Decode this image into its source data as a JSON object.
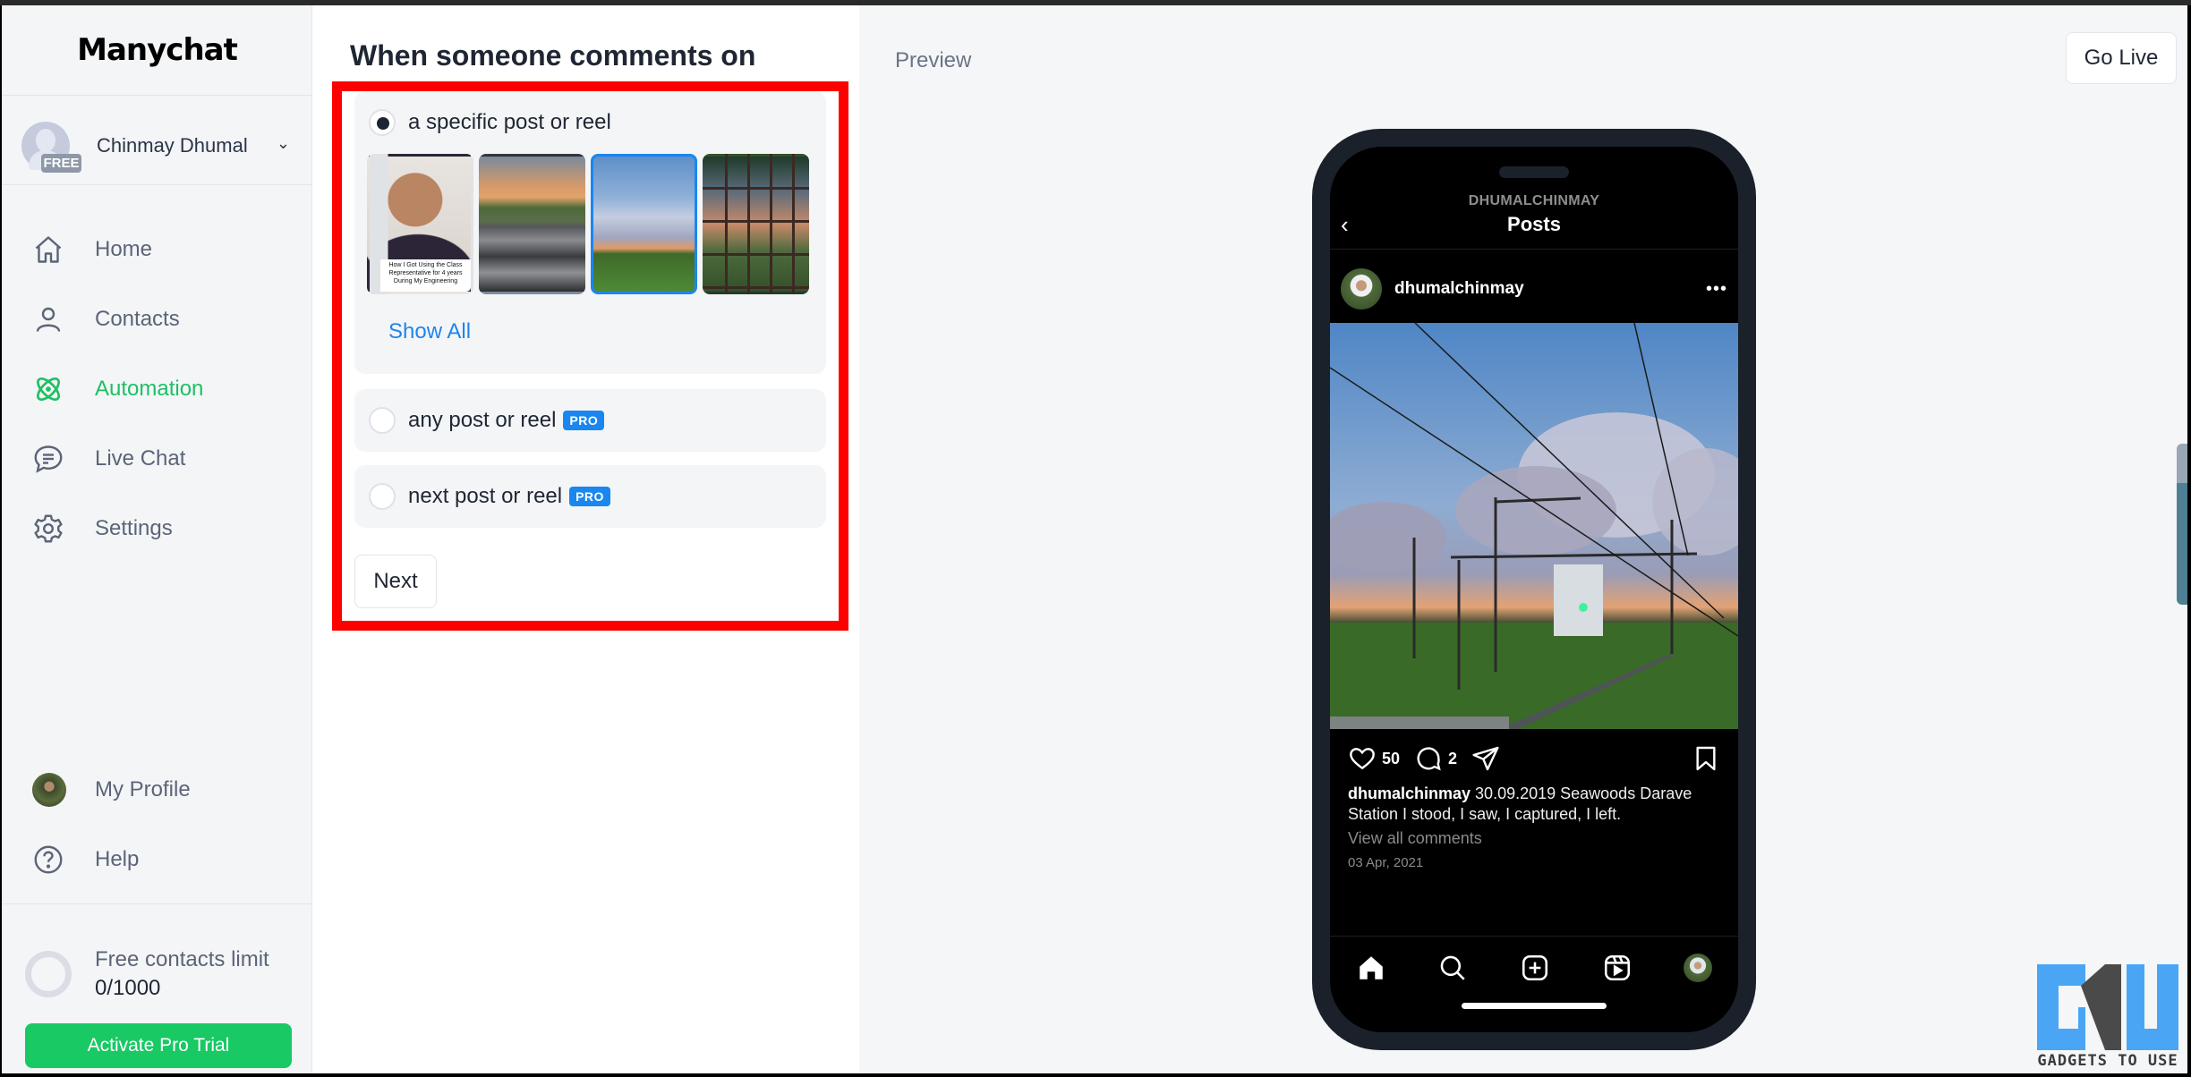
{
  "sidebar": {
    "logo": "Manychat",
    "account": {
      "name": "Chinmay Dhumal",
      "plan_badge": "FREE"
    },
    "nav_items": [
      {
        "label": "Home",
        "icon": "home-icon",
        "active": false
      },
      {
        "label": "Contacts",
        "icon": "user-icon",
        "active": false
      },
      {
        "label": "Automation",
        "icon": "automation-atom-icon",
        "active": true
      },
      {
        "label": "Live Chat",
        "icon": "chat-bubble-icon",
        "active": false
      },
      {
        "label": "Settings",
        "icon": "gear-icon",
        "active": false
      }
    ],
    "bottom_items": [
      {
        "label": "My Profile",
        "icon": "profile-avatar"
      },
      {
        "label": "Help",
        "icon": "help-circle-icon"
      }
    ],
    "contacts_limit": {
      "label": "Free contacts limit",
      "value": "0/1000",
      "used": 0,
      "total": 1000
    },
    "pro_trial_button": "Activate Pro Trial"
  },
  "editor": {
    "title": "When someone comments on",
    "options": [
      {
        "label": "a specific post or reel",
        "checked": true,
        "pro": false
      },
      {
        "label": "any post or reel",
        "checked": false,
        "pro": true,
        "badge": "PRO"
      },
      {
        "label": "next post or reel",
        "checked": false,
        "pro": true,
        "badge": "PRO"
      }
    ],
    "thumbnails": [
      {
        "name": "selfie-post",
        "selected": false,
        "caption": "How I Got Using the Class Representative for 4 years During My Engineering"
      },
      {
        "name": "railway-tracks-sunset-post",
        "selected": false
      },
      {
        "name": "seawoods-station-post",
        "selected": true
      },
      {
        "name": "window-sunset-post",
        "selected": false
      }
    ],
    "show_all_link": "Show All",
    "next_button": "Next"
  },
  "preview": {
    "label": "Preview",
    "go_live_button": "Go Live",
    "instagram": {
      "header_handle": "DHUMALCHINMAY",
      "header_title": "Posts",
      "username": "dhumalchinmay",
      "likes": "50",
      "comments": "2",
      "caption_user": "dhumalchinmay",
      "caption_text": "30.09.2019 Seawoods Darave Station I stood, I saw, I captured, I left.",
      "view_comments": "View all comments",
      "date": "03 Apr, 2021",
      "more_glyph": "•••"
    }
  },
  "watermark": {
    "text": "GADGETS TO USE"
  },
  "colors": {
    "accent_green": "#18c964",
    "link_blue": "#1a86f0",
    "highlight_red": "#ff0000",
    "phone_frame": "#1b212b"
  }
}
